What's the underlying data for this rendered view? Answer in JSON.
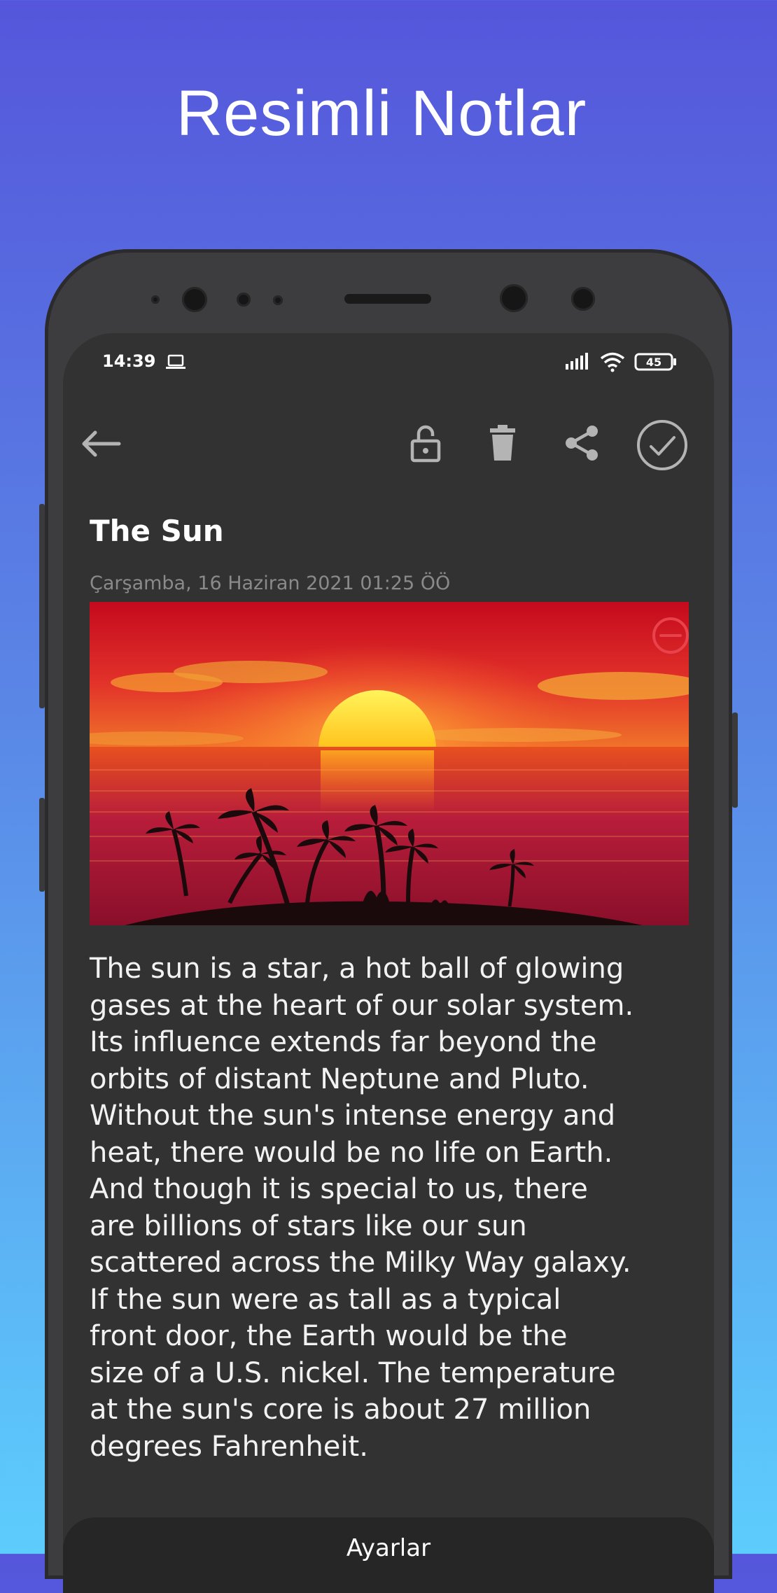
{
  "promo": {
    "title": "Resimli Notlar"
  },
  "status_bar": {
    "time": "14:39",
    "battery": "45"
  },
  "toolbar": {
    "back_icon": "arrow-left-icon",
    "lock_icon": "unlock-icon",
    "delete_icon": "trash-icon",
    "share_icon": "share-icon",
    "save_icon": "check-circle-icon"
  },
  "note": {
    "title": "The Sun",
    "date": "Çarşamba, 16 Haziran 2021 01:25 ÖÖ",
    "body": "The sun is a star, a hot ball of glowing\ngases at the heart of our solar system.\nIts influence extends far beyond the\norbits of distant Neptune and Pluto.\nWithout the sun's intense energy and\nheat, there would be no life on Earth.\nAnd though it is special to us, there\nare billions of stars like our sun\nscattered across the Milky Way galaxy.\nIf the sun were as tall as a typical\nfront door, the Earth would be the\nsize of a U.S. nickel. The temperature\nat the sun's core is about 27 million\ndegrees Fahrenheit."
  },
  "bottom_bar": {
    "label": "Ayarlar"
  },
  "colors": {
    "background_top": "#5556db",
    "background_bottom": "#5dcdfd",
    "screen": "#323232",
    "remove_accent": "#e8424c"
  }
}
